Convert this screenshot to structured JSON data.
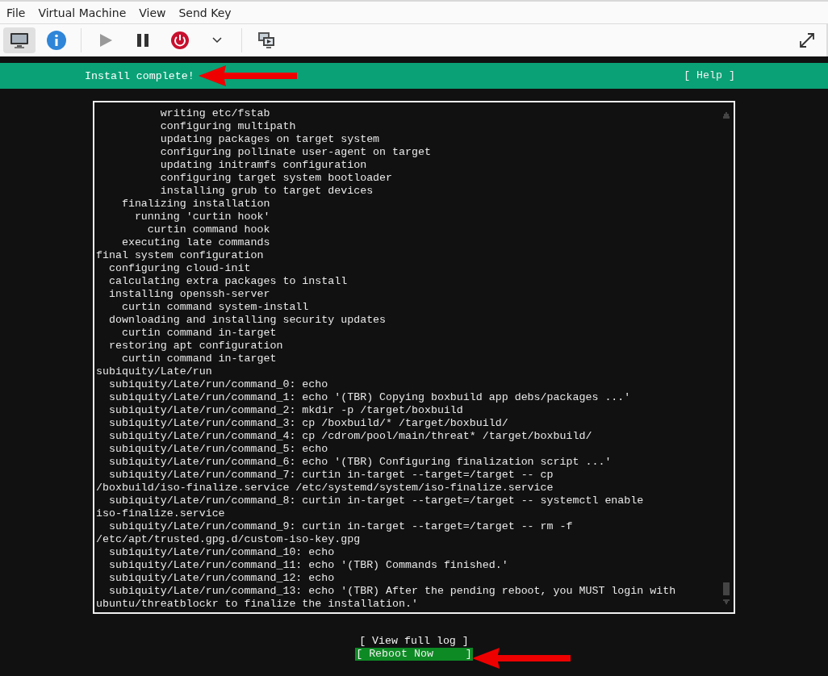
{
  "menu": [
    "File",
    "Virtual Machine",
    "View",
    "Send Key"
  ],
  "toolbar": {
    "console_selected": true,
    "play_disabled": true
  },
  "header": {
    "title": "Install complete!",
    "help": "[ Help ]"
  },
  "log": [
    "          writing etc/fstab",
    "          configuring multipath",
    "          updating packages on target system",
    "          configuring pollinate user-agent on target",
    "          updating initramfs configuration",
    "          configuring target system bootloader",
    "          installing grub to target devices",
    "    finalizing installation",
    "      running 'curtin hook'",
    "        curtin command hook",
    "    executing late commands",
    "final system configuration",
    "  configuring cloud-init",
    "  calculating extra packages to install",
    "  installing openssh-server",
    "    curtin command system-install",
    "  downloading and installing security updates",
    "    curtin command in-target",
    "  restoring apt configuration",
    "    curtin command in-target",
    "subiquity/Late/run",
    "  subiquity/Late/run/command_0: echo",
    "  subiquity/Late/run/command_1: echo '(TBR) Copying boxbuild app debs/packages ...'",
    "  subiquity/Late/run/command_2: mkdir -p /target/boxbuild",
    "  subiquity/Late/run/command_3: cp /boxbuild/* /target/boxbuild/",
    "  subiquity/Late/run/command_4: cp /cdrom/pool/main/threat* /target/boxbuild/",
    "  subiquity/Late/run/command_5: echo",
    "  subiquity/Late/run/command_6: echo '(TBR) Configuring finalization script ...'",
    "  subiquity/Late/run/command_7: curtin in-target --target=/target -- cp",
    "/boxbuild/iso-finalize.service /etc/systemd/system/iso-finalize.service",
    "  subiquity/Late/run/command_8: curtin in-target --target=/target -- systemctl enable",
    "iso-finalize.service",
    "  subiquity/Late/run/command_9: curtin in-target --target=/target -- rm -f",
    "/etc/apt/trusted.gpg.d/custom-iso-key.gpg",
    "  subiquity/Late/run/command_10: echo",
    "  subiquity/Late/run/command_11: echo '(TBR) Commands finished.'",
    "  subiquity/Late/run/command_12: echo",
    "  subiquity/Late/run/command_13: echo '(TBR) After the pending reboot, you MUST login with",
    "ubuntu/threatblockr to finalize the installation.'"
  ],
  "buttons": [
    {
      "label": "[ View full log ]",
      "selected": false
    },
    {
      "label": "[ Reboot Now     ]",
      "selected": true
    }
  ]
}
